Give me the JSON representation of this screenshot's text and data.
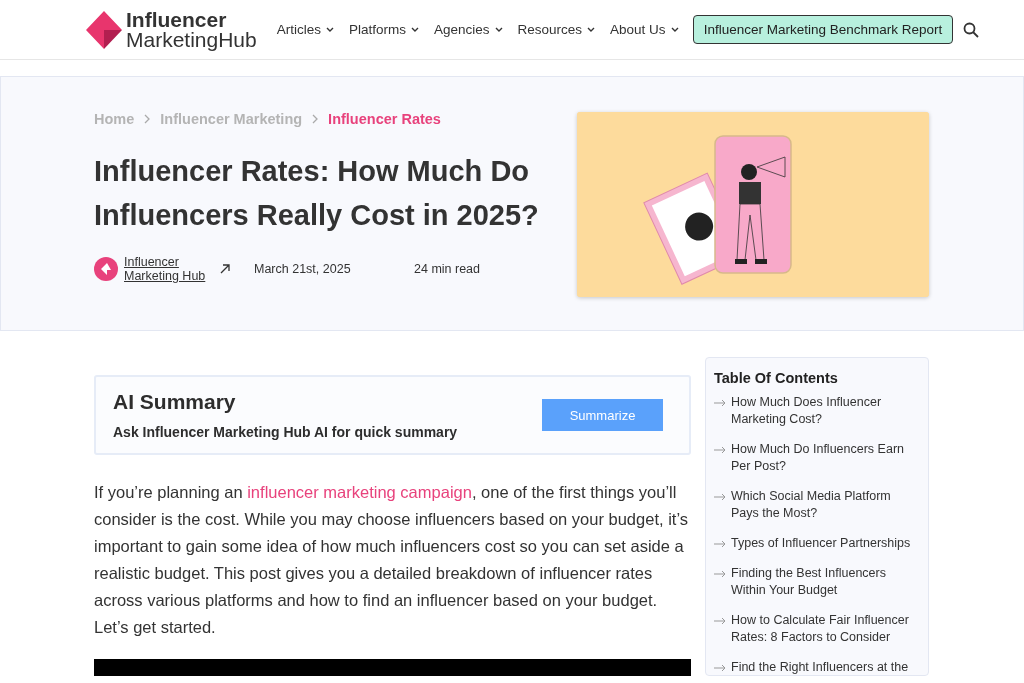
{
  "header": {
    "logo": {
      "line1": "Influencer",
      "line2": "MarketingHub"
    },
    "nav": [
      {
        "label": "Articles"
      },
      {
        "label": "Platforms"
      },
      {
        "label": "Agencies"
      },
      {
        "label": "Resources"
      },
      {
        "label": "About Us"
      }
    ],
    "cta": "Influencer Marketing Benchmark Report"
  },
  "breadcrumbs": [
    {
      "label": "Home",
      "current": false
    },
    {
      "label": "Influencer Marketing",
      "current": false
    },
    {
      "label": "Influencer Rates",
      "current": true
    }
  ],
  "article": {
    "title": "Influencer Rates: How Much Do Influencers Really Cost in 2025?",
    "author": "Influencer Marketing Hub",
    "date": "March 21st, 2025",
    "read_time": "24 min read"
  },
  "ai_summary": {
    "title": "AI Summary",
    "subtitle": "Ask Influencer Marketing Hub AI for quick summary",
    "button": "Summarize"
  },
  "intro": {
    "before": "If you’re planning an ",
    "link": "influencer marketing campaign",
    "after": ", one of the first things you’ll consider is the cost. While you may choose influencers based on your budget, it’s important to gain some idea of how much influencers cost so you can set aside a realistic budget. This post gives you a detailed breakdown of influencer rates across various platforms and how to find an influencer based on your budget. Let’s get started."
  },
  "toc": {
    "title": "Table Of Contents",
    "items": [
      "How Much Does Influencer Marketing Cost?",
      "How Much Do Influencers Earn Per Post?",
      "Which Social Media Platform Pays the Most?",
      "Types of Influencer Partnerships",
      "Finding the Best Influencers Within Your Budget",
      "How to Calculate Fair Influencer Rates: 8 Factors to Consider",
      "Find the Right Influencers at the"
    ]
  }
}
